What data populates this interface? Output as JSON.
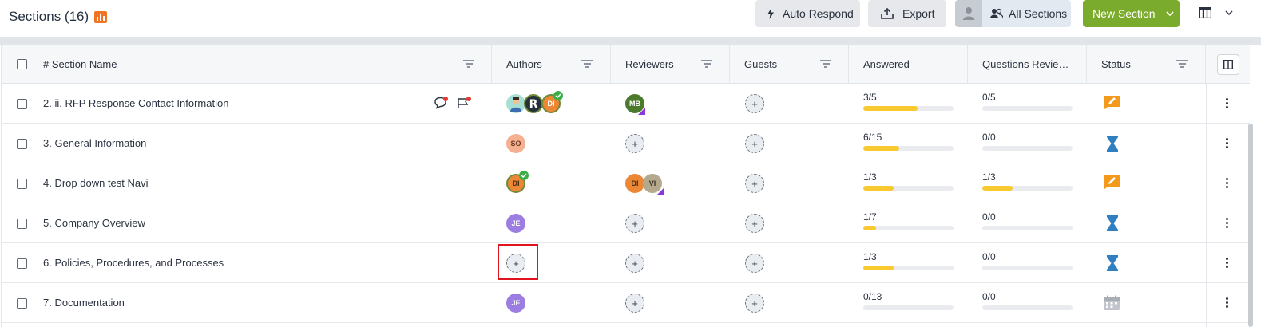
{
  "header": {
    "title": "Sections (16)",
    "auto_respond": "Auto Respond",
    "export": "Export",
    "all_sections": "All Sections",
    "new_section": "New Section"
  },
  "columns": {
    "name": "# Section Name",
    "authors": "Authors",
    "reviewers": "Reviewers",
    "guests": "Guests",
    "answered": "Answered",
    "questions_reviewed": "Questions Revie…",
    "status": "Status"
  },
  "rows": [
    {
      "number": "2.",
      "name": "ii. RFP Response Contact Information",
      "answered": "3/5",
      "answered_fraction": 0.6,
      "reviewed": "0/5",
      "reviewed_fraction": 0,
      "status": "in-progress"
    },
    {
      "number": "3.",
      "name": "General Information",
      "answered": "6/15",
      "answered_fraction": 0.4,
      "reviewed": "0/0",
      "reviewed_fraction": 0,
      "status": "pending"
    },
    {
      "number": "4.",
      "name": "Drop down test Navi",
      "answered": "1/3",
      "answered_fraction": 0.333,
      "reviewed": "1/3",
      "reviewed_fraction": 0.333,
      "status": "in-progress"
    },
    {
      "number": "5.",
      "name": "Company Overview",
      "answered": "1/7",
      "answered_fraction": 0.143,
      "reviewed": "0/0",
      "reviewed_fraction": 0,
      "status": "pending"
    },
    {
      "number": "6.",
      "name": "Policies, Procedures, and Processes",
      "answered": "1/3",
      "answered_fraction": 0.333,
      "reviewed": "0/0",
      "reviewed_fraction": 0,
      "status": "pending"
    },
    {
      "number": "7.",
      "name": "Documentation",
      "answered": "0/13",
      "answered_fraction": 0,
      "reviewed": "0/0",
      "reviewed_fraction": 0,
      "status": "not-started"
    }
  ],
  "avatars": {
    "mb": "MB",
    "so": "SO",
    "di": "DI",
    "vi": "VI",
    "je": "JE",
    "add": "+"
  },
  "colors": {
    "brand_orange": "#f07421",
    "primary_green": "#7bab2c",
    "progress_yellow": "#f9c930",
    "status_orange": "#f39a1d",
    "status_blue": "#2f7fc1",
    "highlight_red": "#e0141d"
  },
  "icons": {
    "title": "chart-icon",
    "auto_respond": "lightning-icon",
    "export": "upload-icon",
    "all_sections": "users-icon",
    "new_section_caret": "chevron-down-icon",
    "table_layout": "table-layout-icon",
    "columns_toggle": "columns-icon",
    "comment": "comment-icon",
    "flag": "flag-icon",
    "status_in_progress": "pencil-icon",
    "status_pending": "hourglass-icon",
    "status_not_started": "calendar-icon",
    "row_menu": "kebab-icon"
  }
}
